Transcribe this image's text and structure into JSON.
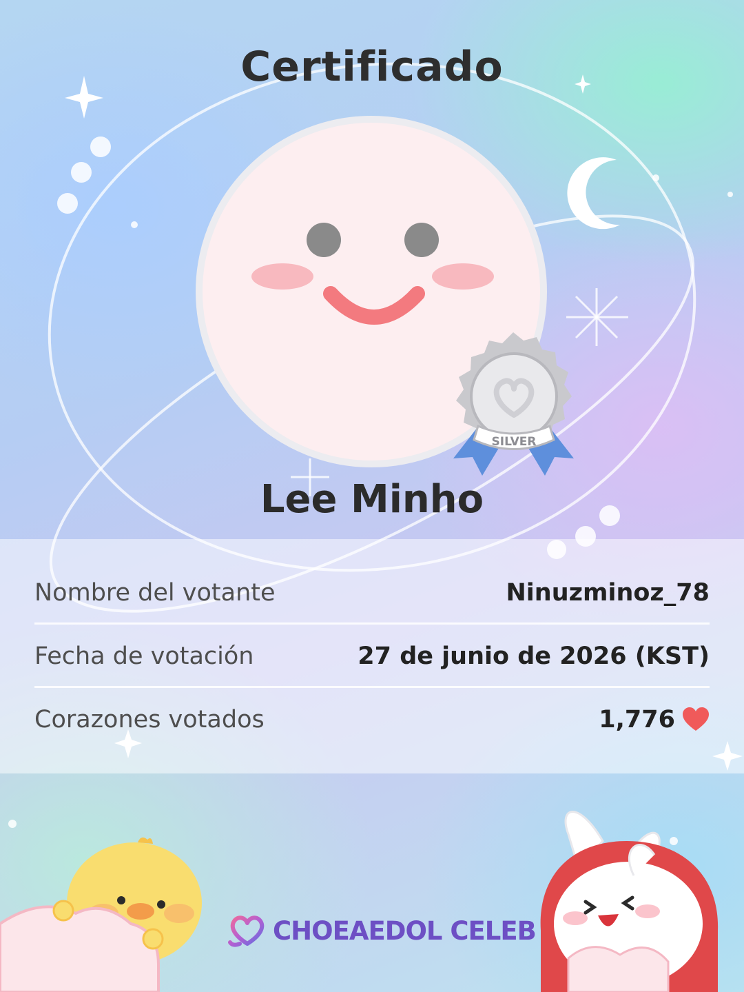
{
  "certificate": {
    "title": "Certificado",
    "celebrity_name": "Lee Minho",
    "medal_label": "SILVER"
  },
  "details": [
    {
      "label": "Nombre del votante",
      "value": "Ninuzminoz_78"
    },
    {
      "label": "Fecha de votación",
      "value": "27 de junio de 2026 (KST)"
    },
    {
      "label": "Corazones votados",
      "value": "1,776"
    }
  ],
  "brand": {
    "name": "CHOEAEDOL CELEB"
  },
  "icons": {
    "avatar": "smiley-face-icon",
    "medal": "silver-medal-icon",
    "heart": "heart-icon",
    "logo": "choeaedol-logo-icon"
  },
  "colors": {
    "heart": "#f05a5a",
    "brand": "#6d4fc4",
    "cheek": "#f8b9bf",
    "smile": "#f37a7f"
  }
}
